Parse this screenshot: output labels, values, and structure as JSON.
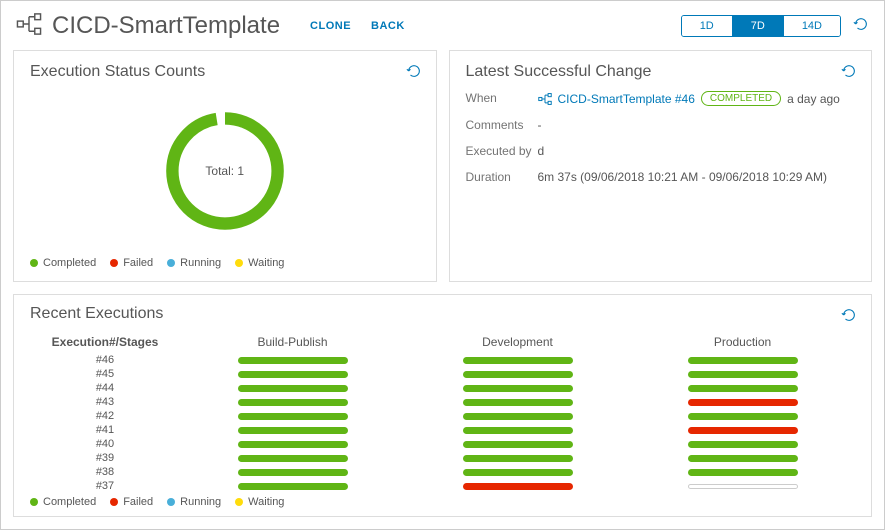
{
  "header": {
    "title": "CICD-SmartTemplate",
    "clone": "CLONE",
    "back": "BACK",
    "ranges": [
      "1D",
      "7D",
      "14D"
    ],
    "active_range": "7D"
  },
  "status_panel": {
    "title": "Execution Status Counts",
    "total_label": "Total: 1",
    "legend": {
      "completed": "Completed",
      "failed": "Failed",
      "running": "Running",
      "waiting": "Waiting"
    }
  },
  "chart_data": {
    "type": "pie",
    "title": "Execution Status Counts",
    "categories": [
      "Completed",
      "Failed",
      "Running",
      "Waiting"
    ],
    "values": [
      1,
      0,
      0,
      0
    ],
    "colors": [
      "#60b515",
      "#e62700",
      "#49afd9",
      "#ffdc0b"
    ],
    "total": 1
  },
  "latest_panel": {
    "title": "Latest Successful Change",
    "when_label": "When",
    "when_link": "CICD-SmartTemplate #46",
    "when_status": "COMPLETED",
    "when_rel": "a day ago",
    "comments_label": "Comments",
    "comments_value": "-",
    "executed_label": "Executed by",
    "executed_value": "d",
    "duration_label": "Duration",
    "duration_value": "6m 37s (09/06/2018 10:21 AM - 09/06/2018 10:29 AM)"
  },
  "recent": {
    "title": "Recent Executions",
    "col_exec": "Execution#/Stages",
    "stages": [
      "Build-Publish",
      "Development",
      "Production"
    ],
    "rows": [
      {
        "id": "#46",
        "s": [
          "green",
          "green",
          "green"
        ]
      },
      {
        "id": "#45",
        "s": [
          "green",
          "green",
          "green"
        ]
      },
      {
        "id": "#44",
        "s": [
          "green",
          "green",
          "green"
        ]
      },
      {
        "id": "#43",
        "s": [
          "green",
          "green",
          "red"
        ]
      },
      {
        "id": "#42",
        "s": [
          "green",
          "green",
          "green"
        ]
      },
      {
        "id": "#41",
        "s": [
          "green",
          "green",
          "red"
        ]
      },
      {
        "id": "#40",
        "s": [
          "green",
          "green",
          "green"
        ]
      },
      {
        "id": "#39",
        "s": [
          "green",
          "green",
          "green"
        ]
      },
      {
        "id": "#38",
        "s": [
          "green",
          "green",
          "green"
        ]
      },
      {
        "id": "#37",
        "s": [
          "green",
          "red",
          "empty"
        ]
      }
    ],
    "legend": {
      "completed": "Completed",
      "failed": "Failed",
      "running": "Running",
      "waiting": "Waiting"
    }
  },
  "colors": {
    "completed": "#60b515",
    "failed": "#e62700",
    "running": "#49afd9",
    "waiting": "#ffdc0b"
  }
}
